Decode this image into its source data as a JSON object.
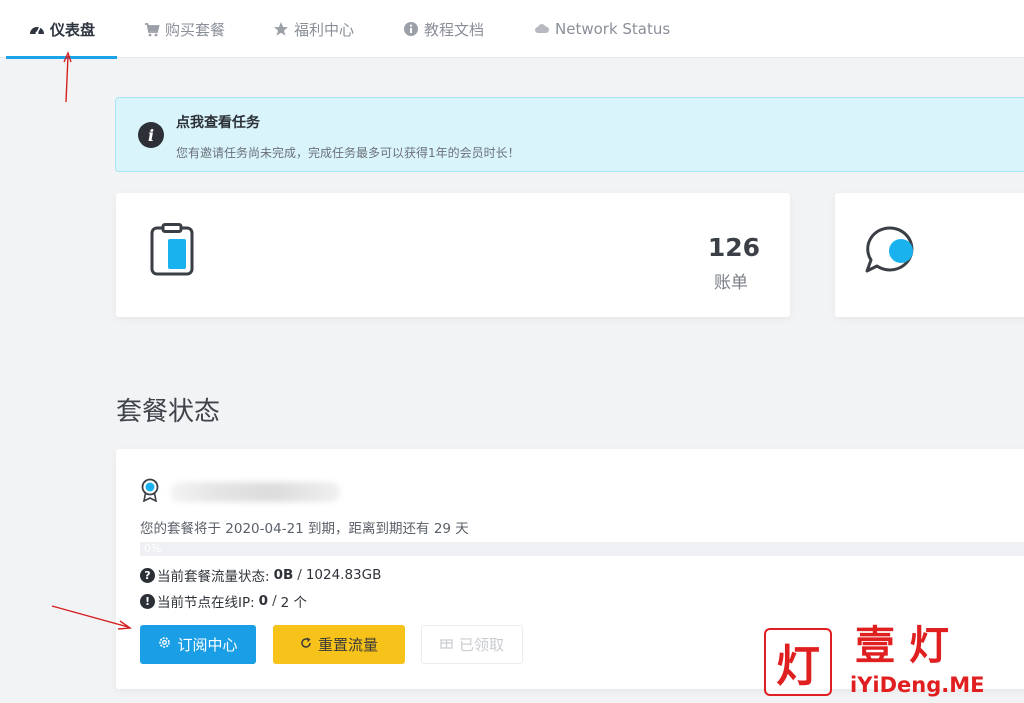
{
  "nav": {
    "tabs": [
      {
        "label": "仪表盘",
        "icon": "dashboard-icon",
        "active": true
      },
      {
        "label": "购买套餐",
        "icon": "cart-icon",
        "active": false
      },
      {
        "label": "福利中心",
        "icon": "star-icon",
        "active": false
      },
      {
        "label": "教程文档",
        "icon": "info-circle-icon",
        "active": false
      },
      {
        "label": "Network Status",
        "icon": "cloud-icon",
        "active": false
      }
    ]
  },
  "notice": {
    "title": "点我查看任务",
    "text": "您有邀请任务尚未完成，完成任务最多可以获得1年的会员时长！",
    "icon": "info-icon"
  },
  "stats": [
    {
      "value": "126",
      "label": "账单",
      "icon": "clipboard-icon"
    },
    {
      "icon": "chat-bubble-icon"
    }
  ],
  "section": {
    "title": "套餐状态"
  },
  "plan": {
    "icon": "award-icon",
    "expiry_text": "您的套餐将于 2020-04-21 到期，距离到期还有 29 天",
    "progress_label": "0%",
    "progress_fraction": 0,
    "traffic_label": "当前套餐流量状态:",
    "traffic_used": "0B",
    "traffic_separator": "/",
    "traffic_total": "1024.83GB",
    "online_label": "当前节点在线IP:",
    "online_current": "0",
    "online_separator": "/",
    "online_total": "2 个",
    "buttons": {
      "subscribe": "订阅中心",
      "reset": "重置流量",
      "claimed": "已领取"
    }
  },
  "watermark": {
    "logo_char": "灯",
    "cn": "壹灯",
    "en": "iYiDeng.ME"
  },
  "colors": {
    "accent": "#1aa3e8",
    "warning": "#f7c31a",
    "notice_bg": "#d9f5fb",
    "watermark": "#e02020"
  }
}
